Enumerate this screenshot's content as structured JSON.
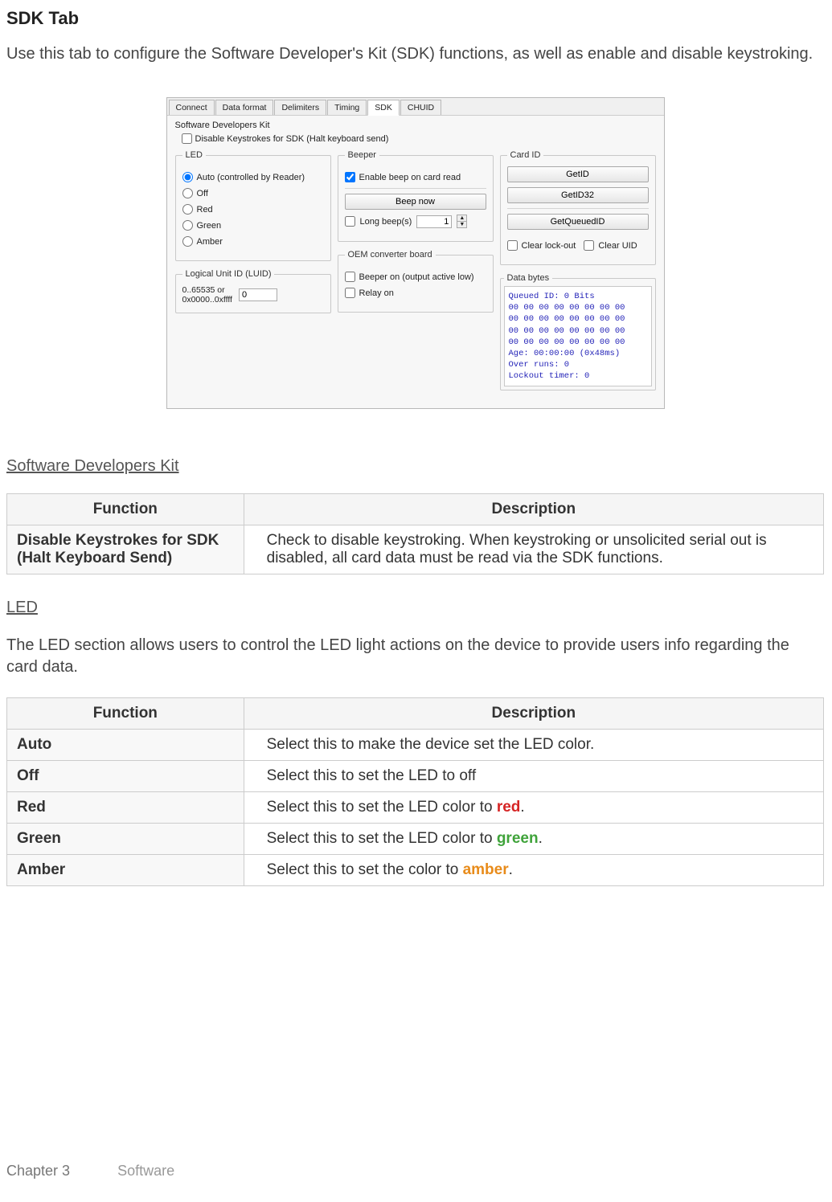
{
  "page": {
    "heading": "SDK Tab",
    "intro": "Use this tab to configure the Software Developer's Kit (SDK) functions, as well as enable and disable keystroking."
  },
  "dialog": {
    "tabs": [
      "Connect",
      "Data format",
      "Delimiters",
      "Timing",
      "SDK",
      "CHUID"
    ],
    "active_tab_index": 4,
    "sdk_title": "Software Developers Kit",
    "disable_keystrokes": {
      "label": "Disable Keystrokes for SDK (Halt keyboard send)",
      "checked": false
    },
    "led": {
      "legend": "LED",
      "options": [
        {
          "label": "Auto (controlled by Reader)",
          "checked": true
        },
        {
          "label": "Off",
          "checked": false
        },
        {
          "label": "Red",
          "checked": false
        },
        {
          "label": "Green",
          "checked": false
        },
        {
          "label": "Amber",
          "checked": false
        }
      ]
    },
    "luid": {
      "legend": "Logical Unit ID (LUID)",
      "range": "0..65535 or\n0x0000..0xffff",
      "value": "0"
    },
    "beeper": {
      "legend": "Beeper",
      "enable": {
        "label": "Enable beep on card read",
        "checked": true
      },
      "beep_now": "Beep now",
      "long_beep_label": "Long beep(s)",
      "long_beep_checked": false,
      "long_beep_value": "1"
    },
    "oem": {
      "legend": "OEM converter board",
      "beeper_on": {
        "label": "Beeper on (output active low)",
        "checked": false
      },
      "relay_on": {
        "label": "Relay on",
        "checked": false
      }
    },
    "card_id": {
      "legend": "Card ID",
      "btn_getid": "GetID",
      "btn_getid32": "GetID32",
      "btn_getqueued": "GetQueuedID",
      "clear_lockout": {
        "label": "Clear lock-out",
        "checked": false
      },
      "clear_uid": {
        "label": "Clear UID",
        "checked": false
      }
    },
    "data_bytes": {
      "legend": "Data bytes",
      "text": "Queued ID: 0 Bits\n00 00 00 00 00 00 00 00\n00 00 00 00 00 00 00 00\n00 00 00 00 00 00 00 00\n00 00 00 00 00 00 00 00\nAge: 00:00:00 (0x48ms)\nOver runs: 0\nLockout timer: 0"
    }
  },
  "sections": {
    "sdk_table": {
      "title": "Software Developers Kit",
      "headers": [
        "Function",
        "Description"
      ],
      "rows": [
        {
          "fn": "Disable Keystrokes for SDK (Halt Keyboard Send)",
          "desc": "Check to disable keystroking. When keystroking or unsolicited serial out is disabled, all card data must be read via the SDK functions."
        }
      ]
    },
    "led_section": {
      "title": "LED",
      "para": "The LED section allows users to control the LED light actions on the device to provide users info regarding the card data.",
      "headers": [
        "Function",
        "Description"
      ],
      "rows": [
        {
          "fn": "Auto",
          "fn_class": "",
          "desc_pre": "Select this to make the device set the LED color.",
          "desc_hl": "",
          "desc_post": ""
        },
        {
          "fn": "Off",
          "fn_class": "",
          "desc_pre": "Select this to set the LED to off",
          "desc_hl": "",
          "desc_post": ""
        },
        {
          "fn": "Red",
          "fn_class": "c-red",
          "desc_pre": "Select this to set the LED color to ",
          "desc_hl": "red",
          "hl_class": "c-red",
          "desc_post": "."
        },
        {
          "fn": "Green",
          "fn_class": "c-green",
          "desc_pre": "Select this to set the LED color to ",
          "desc_hl": "green",
          "hl_class": "c-green",
          "desc_post": "."
        },
        {
          "fn": "Amber",
          "fn_class": "c-amber",
          "desc_pre": "Select this to set the color to ",
          "desc_hl": "amber",
          "hl_class": "c-amber",
          "desc_post": "."
        }
      ]
    }
  },
  "footer": {
    "chapter": "Chapter 3",
    "section": "Software"
  }
}
